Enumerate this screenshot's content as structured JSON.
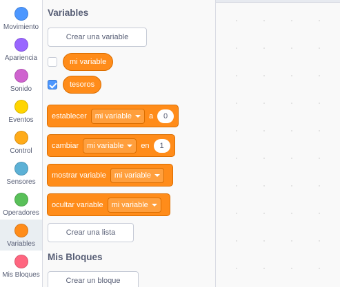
{
  "categories": [
    {
      "label": "Movimiento",
      "color": "#4c97ff",
      "selected": false
    },
    {
      "label": "Apariencia",
      "color": "#9966ff",
      "selected": false
    },
    {
      "label": "Sonido",
      "color": "#cf63cf",
      "selected": false
    },
    {
      "label": "Eventos",
      "color": "#ffd500",
      "selected": false
    },
    {
      "label": "Control",
      "color": "#ffab19",
      "selected": false
    },
    {
      "label": "Sensores",
      "color": "#5cb1d6",
      "selected": false
    },
    {
      "label": "Operadores",
      "color": "#59c059",
      "selected": false
    },
    {
      "label": "Variables",
      "color": "#ff8c1a",
      "selected": true
    },
    {
      "label": "Mis Bloques",
      "color": "#ff6680",
      "selected": false
    }
  ],
  "palette": {
    "variables_title": "Variables",
    "make_variable_button": "Crear una variable",
    "variables": [
      {
        "name": "mi variable",
        "checked": false
      },
      {
        "name": "tesoros",
        "checked": true
      }
    ],
    "blocks": {
      "set": {
        "label": "establecer",
        "dropdown": "mi variable",
        "to_label": "a",
        "value": "0"
      },
      "change": {
        "label": "cambiar",
        "dropdown": "mi variable",
        "by_label": "en",
        "value": "1"
      },
      "show": {
        "label": "mostrar variable",
        "dropdown": "mi variable"
      },
      "hide": {
        "label": "ocultar variable",
        "dropdown": "mi variable"
      }
    },
    "make_list_button": "Crear una lista",
    "my_blocks_title": "Mis Bloques",
    "make_block_button": "Crear un bloque"
  },
  "colors": {
    "variables_block": "#ff8c1a",
    "variables_block_border": "#db6e00",
    "checkbox_checked": "#4c97ff"
  }
}
